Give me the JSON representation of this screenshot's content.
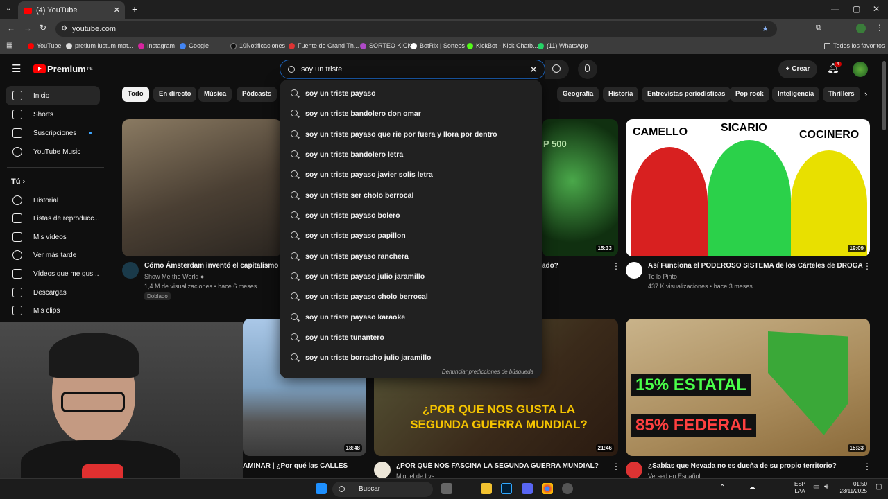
{
  "browser": {
    "tab_title": "(4) YouTube",
    "url": "youtube.com",
    "bookmarks": [
      "YouTube",
      "pretium iustum mat...",
      "Instagram",
      "Google",
      "10Notificaciones",
      "Fuente de Grand Th...",
      "SORTEO KICK",
      "BotRix | Sorteos",
      "KickBot - Kick Chatb...",
      "(11) WhatsApp"
    ],
    "all_bookmarks": "Todos los favoritos"
  },
  "youtube": {
    "logo_text": "Premium",
    "logo_sup": "PE",
    "search_value": "soy un triste",
    "create_label": "Crear",
    "notif_count": "4",
    "chips": [
      "Todo",
      "En directo",
      "Música",
      "Pódcasts",
      "Geografía",
      "Historia",
      "Entrevistas periodísticas",
      "Pop rock",
      "Inteligencia",
      "Thrillers"
    ],
    "sidebar": {
      "main": [
        "Inicio",
        "Shorts",
        "Suscripciones",
        "YouTube Music"
      ],
      "you_header": "Tú",
      "you": [
        "Historial",
        "Listas de reproducc...",
        "Mis vídeos",
        "Ver más tarde",
        "Vídeos que me gus...",
        "Descargas",
        "Mis clips"
      ]
    },
    "suggestions": [
      "soy un triste payaso",
      "soy un triste bandolero don omar",
      "soy un triste payaso que rie por fuera y llora por dentro",
      "soy un triste bandolero letra",
      "soy un triste payaso javier solis letra",
      "soy un triste ser cholo berrocal",
      "soy un triste payaso bolero",
      "soy un triste payaso papillon",
      "soy un triste payaso ranchera",
      "soy un triste payaso julio jaramillo",
      "soy un triste payaso cholo berrocal",
      "soy un triste payaso karaoke",
      "soy un triste tunantero",
      "soy un triste borracho julio jaramillo"
    ],
    "report_label": "Denunciar predicciones de búsqueda",
    "videos": [
      {
        "title": "Cómo Ámsterdam inventó el capitalismo",
        "channel": "Show Me the World",
        "meta": "1,4 M de visualizaciones • hace 6 meses",
        "badge": "Doblado"
      },
      {
        "title": "ado?",
        "duration": "15:33"
      },
      {
        "title": "Así Funciona el PODEROSO SISTEMA de los Cárteles de DROGA",
        "channel": "Te lo Pinto",
        "meta": "437 K visualizaciones • hace 3 meses",
        "duration": "19:09",
        "thumb_words": [
          "CAMELLO",
          "SICARIO",
          "COCINERO"
        ]
      },
      {
        "title": "AMINAR | ¿Por qué las CALLES",
        "duration": "18:48"
      },
      {
        "title": "¿POR QUÉ NOS FASCINA LA SEGUNDA GUERRA MUNDIAL?",
        "channel": "Miguel de Lys",
        "duration": "21:46",
        "thumb_text": [
          "¿POR QUE NOS GUSTA LA",
          "SEGUNDA GUERRA MUNDIAL?"
        ]
      },
      {
        "title": "¿Sabías que Nevada no es dueña de su propio territorio?",
        "channel": "Versed en Español",
        "duration": "15:33",
        "thumb_text": [
          "15% ESTATAL",
          "85% FEDERAL"
        ]
      }
    ]
  },
  "taskbar": {
    "search_label": "Buscar",
    "lang": "ESP",
    "lang2": "LAA",
    "time": "01:50",
    "date": "23/11/2025"
  }
}
